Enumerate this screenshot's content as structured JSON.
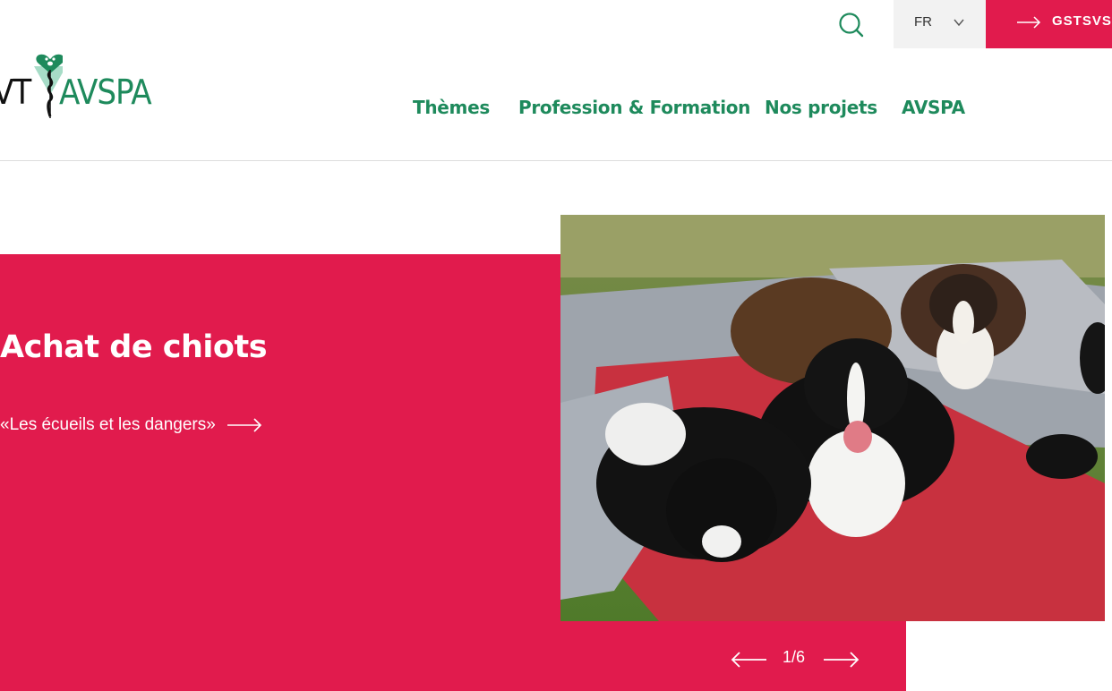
{
  "brand": {
    "logo_left": "VT",
    "logo_right": "AVSPA",
    "green": "#1e8a5c",
    "red": "#e11b4d"
  },
  "topbar": {
    "search_icon": "search-icon",
    "language": "FR",
    "gst_label": "GSTSVS"
  },
  "nav": {
    "items": [
      {
        "label": "Thèmes"
      },
      {
        "label": "Profession & Formation"
      },
      {
        "label": "Nos projets"
      },
      {
        "label": "AVSPA"
      }
    ]
  },
  "hero": {
    "title": "Achat de chiots",
    "link_text": "«Les écueils et les dangers»"
  },
  "carousel": {
    "counter": "1/6"
  }
}
